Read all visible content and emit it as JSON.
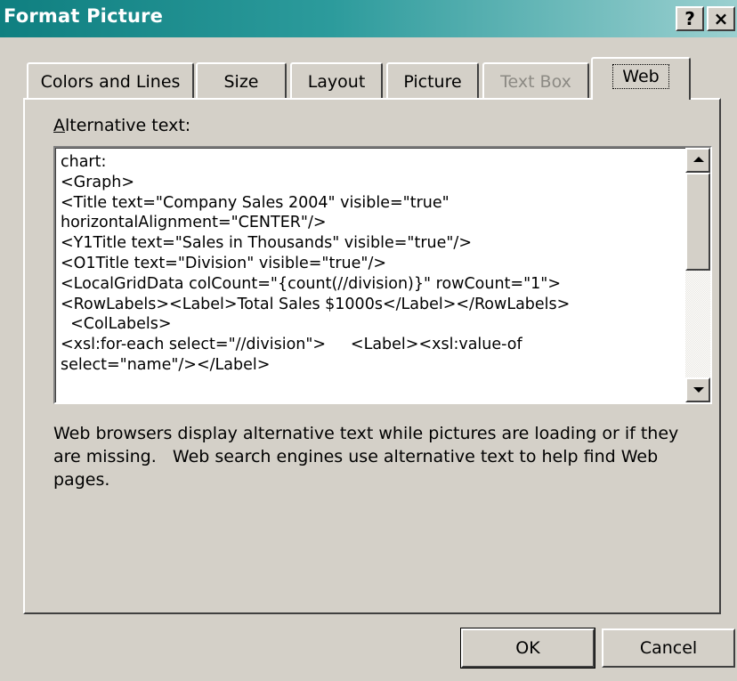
{
  "window": {
    "title": "Format Picture",
    "help_label": "?",
    "close_label": "×"
  },
  "tabs": [
    {
      "label": "Colors and Lines",
      "enabled": true,
      "active": false
    },
    {
      "label": "Size",
      "enabled": true,
      "active": false
    },
    {
      "label": "Layout",
      "enabled": true,
      "active": false
    },
    {
      "label": "Picture",
      "enabled": true,
      "active": false
    },
    {
      "label": "Text Box",
      "enabled": false,
      "active": false
    },
    {
      "label": "Web",
      "enabled": true,
      "active": true
    }
  ],
  "web_tab": {
    "alt_text_label_accel": "A",
    "alt_text_label_rest": "lternative text:",
    "alt_text_lines": [
      "chart:",
      "<Graph>",
      "<Title text=\"Company Sales 2004\" visible=\"true\"",
      "horizontalAlignment=\"CENTER\"/>",
      "<Y1Title text=\"Sales in Thousands\" visible=\"true\"/>",
      "<O1Title text=\"Division\" visible=\"true\"/>",
      "<LocalGridData colCount=\"{count(//division)}\" rowCount=\"1\">",
      "<RowLabels><Label>Total Sales $1000s</Label></RowLabels>",
      "  <ColLabels>",
      "<xsl:for-each select=\"//division\">     <Label><xsl:value-of",
      "select=\"name\"/></Label>"
    ],
    "description": "Web browsers display alternative text while pictures are loading or if they\nare missing.   Web search engines use alternative text to help find Web\npages."
  },
  "buttons": {
    "ok_label": "OK",
    "cancel_label": "Cancel"
  },
  "colors": {
    "titlebar_start": "#0f7f80",
    "titlebar_end": "#9bd0d0",
    "face": "#d4d0c8",
    "disabled_text": "#8c8a84"
  }
}
